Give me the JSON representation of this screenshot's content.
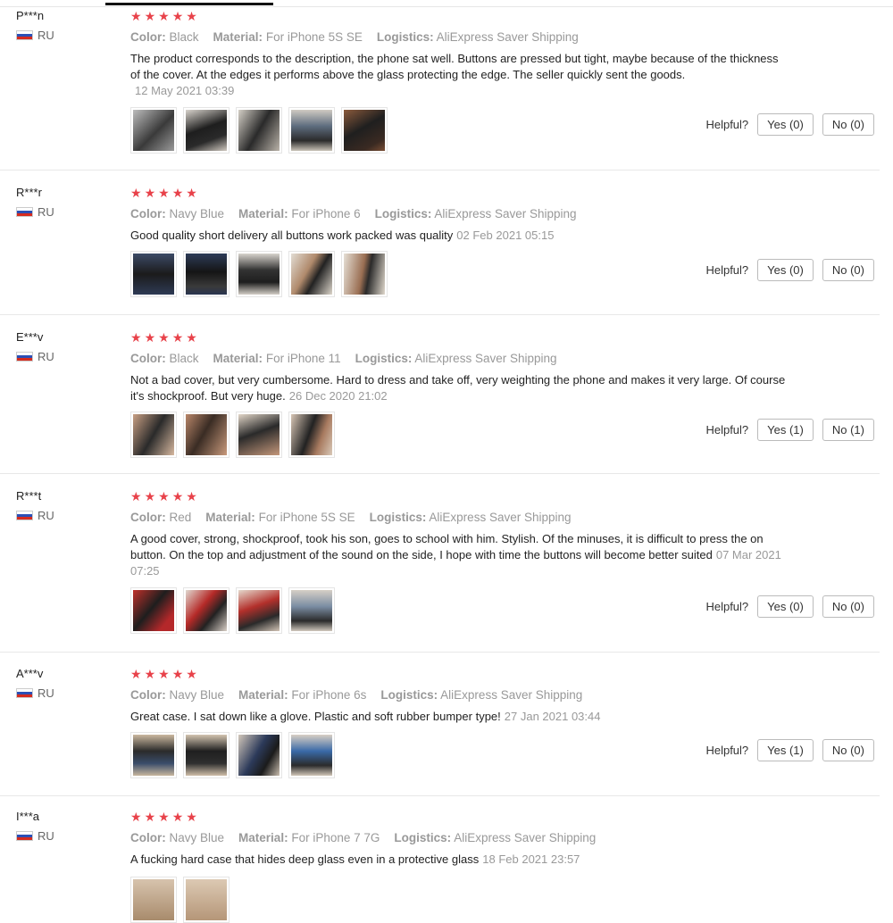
{
  "labels": {
    "color": "Color:",
    "material": "Material:",
    "logistics": "Logistics:",
    "helpful": "Helpful?"
  },
  "reviews": [
    {
      "user": "P***n",
      "country": "RU",
      "color": "Black",
      "material": "For iPhone 5S SE",
      "logistics": "AliExpress Saver Shipping",
      "text": "The product corresponds to the description, the phone sat well. Buttons are pressed but tight, maybe because of the thickness of the cover. At the edges it performs above the glass protecting the edge. The seller quickly sent the goods.",
      "date": "12 May 2021 03:39",
      "yes": "Yes (0)",
      "no": "No (0)",
      "photos": 5
    },
    {
      "user": "R***r",
      "country": "RU",
      "color": "Navy Blue",
      "material": "For iPhone 6",
      "logistics": "AliExpress Saver Shipping",
      "text": "Good quality short delivery all buttons work packed was quality",
      "date": "02 Feb 2021 05:15",
      "yes": "Yes (0)",
      "no": "No (0)",
      "photos": 5
    },
    {
      "user": "E***v",
      "country": "RU",
      "color": "Black",
      "material": "For iPhone 11",
      "logistics": "AliExpress Saver Shipping",
      "text": "Not a bad cover, but very cumbersome. Hard to dress and take off, very weighting the phone and makes it very large. Of course it's shockproof. But very huge.",
      "date": "26 Dec 2020 21:02",
      "yes": "Yes (1)",
      "no": "No (1)",
      "photos": 4
    },
    {
      "user": "R***t",
      "country": "RU",
      "color": "Red",
      "material": "For iPhone 5S SE",
      "logistics": "AliExpress Saver Shipping",
      "text": "A good cover, strong, shockproof, took his son, goes to school with him. Stylish. Of the minuses, it is difficult to press the on button. On the top and adjustment of the sound on the side, I hope with time the buttons will become better suited",
      "date": "07 Mar 2021 07:25",
      "yes": "Yes (0)",
      "no": "No (0)",
      "photos": 4
    },
    {
      "user": "A***v",
      "country": "RU",
      "color": "Navy Blue",
      "material": "For iPhone 6s",
      "logistics": "AliExpress Saver Shipping",
      "text": "Great case. I sat down like a glove. Plastic and soft rubber bumper type!",
      "date": "27 Jan 2021 03:44",
      "yes": "Yes (1)",
      "no": "No (0)",
      "photos": 4
    },
    {
      "user": "I***a",
      "country": "RU",
      "color": "Navy Blue",
      "material": "For iPhone 7 7G",
      "logistics": "AliExpress Saver Shipping",
      "text": "A fucking hard case that hides deep glass even in a protective glass",
      "date": "18 Feb 2021 23:57",
      "photos": 2
    }
  ]
}
